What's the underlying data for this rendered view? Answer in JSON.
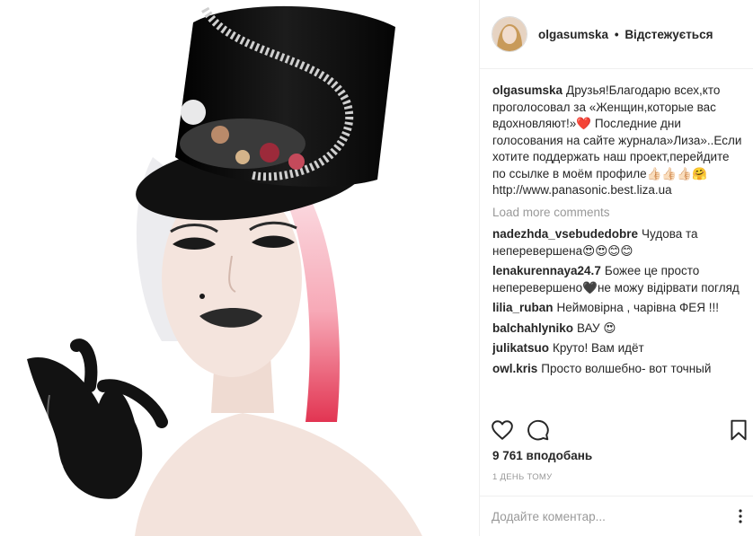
{
  "post": {
    "author": "olgasumska",
    "separator": "•",
    "follow_status": "Відстежується",
    "caption_user": "olgasumska",
    "caption_text": "Друзья!Благодарю всех,кто проголосовал за «Женщин,которые вас вдохновляют!»❤️ Последние дни голосования на сайте журнала»Лиза»..Если хотите поддержать наш проект,перейдите по ссылке в моём профиле👍🏻👍🏻👍🏻🤗 http://www.panasonic.best.liza.ua",
    "load_more": "Load more comments",
    "comments": [
      {
        "user": "nadezhda_vsebudedobre",
        "text": "Чудова та неперевершена😍😍😊😊"
      },
      {
        "user": "lenakurennaya24.7",
        "text": "Божее це просто неперевершено🖤не можу відірвати погляд"
      },
      {
        "user": "lilia_ruban",
        "text": "Неймовірна , чарівна ФЕЯ !!!"
      },
      {
        "user": "balchahlyniko",
        "text": "ВАУ 😍"
      },
      {
        "user": "julikatsuo",
        "text": "Круто! Вам идёт"
      },
      {
        "user": "owl.kris",
        "text": "Просто волшебно- вот точный"
      }
    ],
    "likes": "9 761 вподобань",
    "time_ago": "1 ДЕНЬ ТОМУ",
    "comment_placeholder": "Додайте коментар..."
  },
  "icons": {
    "like": "heart-icon",
    "comment": "speech-bubble-icon",
    "save": "bookmark-icon",
    "more": "more-options-icon"
  },
  "colors": {
    "text": "#262626",
    "muted": "#999999",
    "divider": "#efefef",
    "hat": "#0d0d0d",
    "hair_pink": "#f06a7f"
  }
}
